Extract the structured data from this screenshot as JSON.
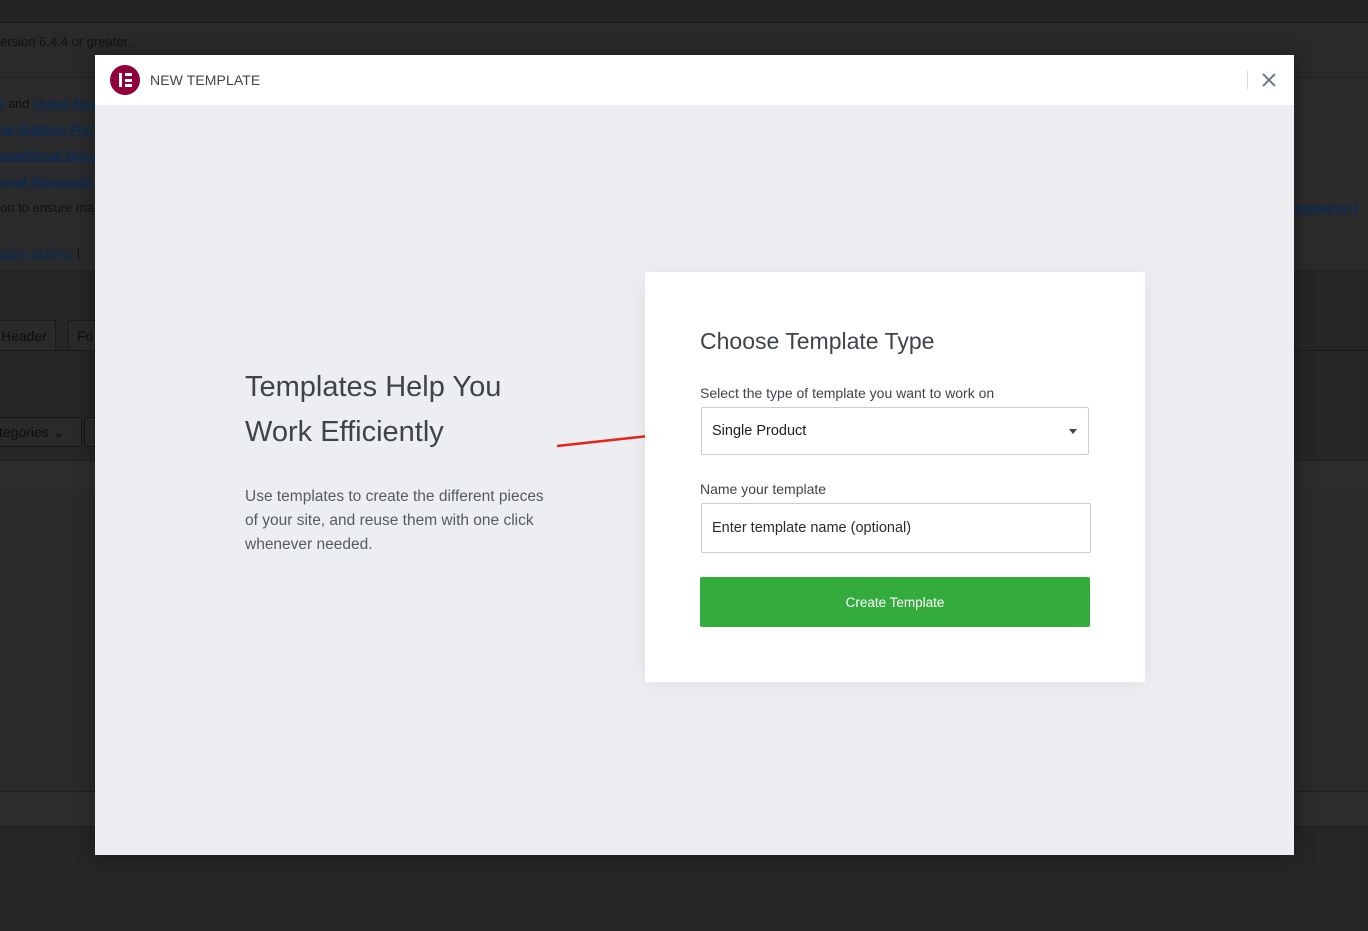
{
  "background": {
    "notice_version": "ersion 6.4.4 or greater.",
    "notice_lines": [
      {
        "link": "t",
        "mid": " and ",
        "link2": "Quick Fea"
      },
      {
        "link": "ve Addons For E"
      },
      {
        "link": "onditional Disco"
      },
      {
        "link": "onal Discounts"
      }
    ],
    "notice_ensure": "on to ensure ma",
    "notice_commerce": "ommerce (",
    "activating_link": "ating plugins",
    "activating_sep": " | ",
    "tabs": [
      "Header",
      "Fo"
    ],
    "categories_select": "tegories"
  },
  "modal": {
    "title": "New Template",
    "close_icon": "close-icon",
    "logo_icon": "elementor-logo-icon",
    "intro": {
      "heading": "Templates Help You Work Efficiently",
      "text": "Use templates to create the different pieces of your site, and reuse them with one click whenever needed."
    },
    "form": {
      "title": "Choose Template Type",
      "type_label": "Select the type of template you want to work on",
      "type_selected": "Single Product",
      "name_label": "Name your template",
      "name_placeholder": "Enter template name (optional)",
      "name_value": "",
      "submit_label": "Create Template"
    }
  },
  "colors": {
    "brand": "#92003b",
    "create_button": "#33ac3d",
    "arrow": "#e8221b"
  }
}
